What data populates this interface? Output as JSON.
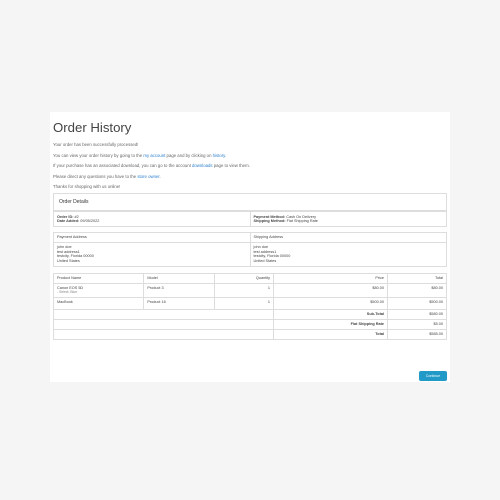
{
  "page": {
    "title": "Order History",
    "messages": [
      {
        "text": "Your order has been successfully processed!"
      },
      {
        "prefix": "You can view your order history by going to the ",
        "link1": "my account",
        "middle": " page and by clicking on ",
        "link2": "history",
        "suffix": "."
      },
      {
        "prefix": "If your purchase has an associated download, you can go to the account ",
        "link": "downloads",
        "suffix": " page to view them."
      },
      {
        "prefix": "Please direct any questions you have to the ",
        "link": "store owner",
        "suffix": "."
      },
      {
        "text": "Thanks for shopping with us online!"
      }
    ]
  },
  "order_details": {
    "header": "Order Details",
    "order_id_label": "Order ID:",
    "order_id": "#2",
    "date_added_label": "Date Added:",
    "date_added": "09/05/2022",
    "payment_method_label": "Payment Method:",
    "payment_method": "Cash On Delivery",
    "shipping_method_label": "Shipping Method:",
    "shipping_method": "Flat Shipping Rate"
  },
  "addresses": {
    "payment_header": "Payment Address",
    "shipping_header": "Shipping Address",
    "payment_lines": [
      "john doe",
      "test address1",
      "testcity, Florida 00000",
      "United States"
    ],
    "shipping_lines": [
      "john doe",
      "test address1",
      "testcity, Florida 00000",
      "United States"
    ]
  },
  "products": {
    "headers": {
      "name": "Product Name",
      "model": "Model",
      "quantity": "Quantity",
      "price": "Price",
      "total": "Total"
    },
    "rows": [
      {
        "name": "Canon EOS 5D",
        "option": "- Select: Blue",
        "model": "Product 3",
        "quantity": "1",
        "price": "$80.00",
        "total": "$80.00"
      },
      {
        "name": "MacBook",
        "option": "",
        "model": "Product 16",
        "quantity": "1",
        "price": "$500.00",
        "total": "$500.00"
      }
    ],
    "totals": [
      {
        "label": "Sub-Total",
        "value": "$580.00"
      },
      {
        "label": "Flat Shipping Rate",
        "value": "$5.00"
      },
      {
        "label": "Total",
        "value": "$585.00"
      }
    ]
  },
  "actions": {
    "continue_label": "Continue"
  }
}
